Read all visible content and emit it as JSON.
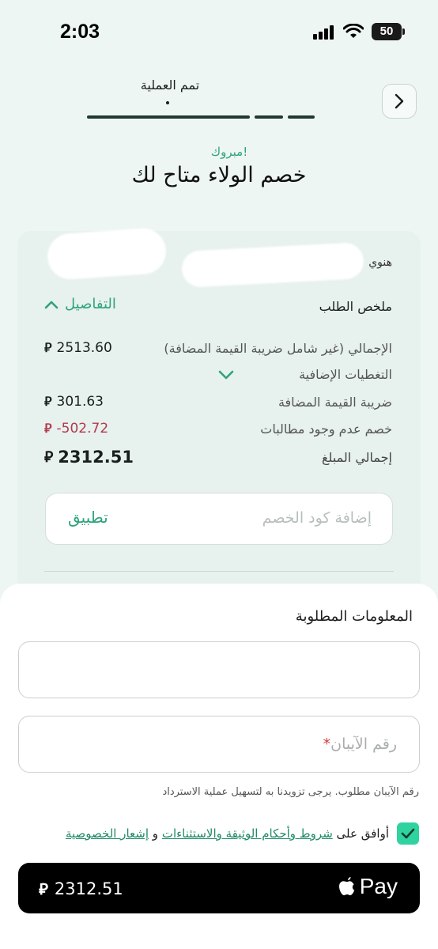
{
  "status_bar": {
    "time": "2:03",
    "battery": "50"
  },
  "header": {
    "step_label": "تمم العملية",
    "back_icon": "chevron-right-icon"
  },
  "hero": {
    "congrats": "مبروك!",
    "title": "خصم الولاء متاح لك"
  },
  "summary": {
    "name_partial": "هنوي",
    "title": "ملخص الطلب",
    "details_toggle": "التفاصيل",
    "currency_symbol": "⃁",
    "rows": [
      {
        "label": "الإجمالي (غير شامل ضريبة القيمة المضافة)",
        "value": "2513.60"
      },
      {
        "label": "التغطيات الإضافية",
        "value": ""
      },
      {
        "label": "ضريبة القيمة المضافة",
        "value": "301.63"
      },
      {
        "label": "خصم عدم وجود مطالبات",
        "value": "-502.72"
      },
      {
        "label": "إجمالي المبلغ",
        "value": "2312.51"
      }
    ]
  },
  "coupon": {
    "placeholder": "إضافة كود الخصم",
    "apply": "تطبيق"
  },
  "required_info": {
    "title": "المعلومات المطلوبة",
    "iban_placeholder": "رقم الآيبان",
    "required_star": "*",
    "helper": "رقم الآيبان مطلوب. يرجى تزويدنا به لتسهيل عملية الاسترداد"
  },
  "agreement": {
    "prefix": "أوافق على",
    "terms_link": "شروط وأحكام الوثيقة والاستثناءات",
    "and": "و",
    "privacy_link": "إشعار الخصوصية"
  },
  "pay_button": {
    "amount": "2312.51",
    "brand": "Pay"
  },
  "colors": {
    "accent": "#2fa37d",
    "negative": "#b23a4a",
    "checkbox": "#2fd3a0"
  }
}
